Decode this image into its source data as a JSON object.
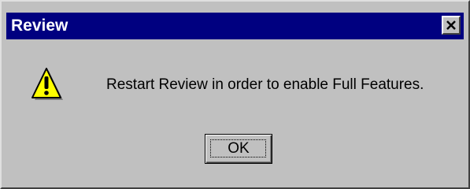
{
  "window": {
    "title": "Review",
    "close_icon": "close-icon",
    "title_bar_color": "#000080",
    "body_color": "#c0c0c0"
  },
  "dialog": {
    "icon": "warning-icon",
    "icon_color": "#ffff00",
    "message": "Restart Review in order to enable Full Features.",
    "ok_label": "OK"
  }
}
